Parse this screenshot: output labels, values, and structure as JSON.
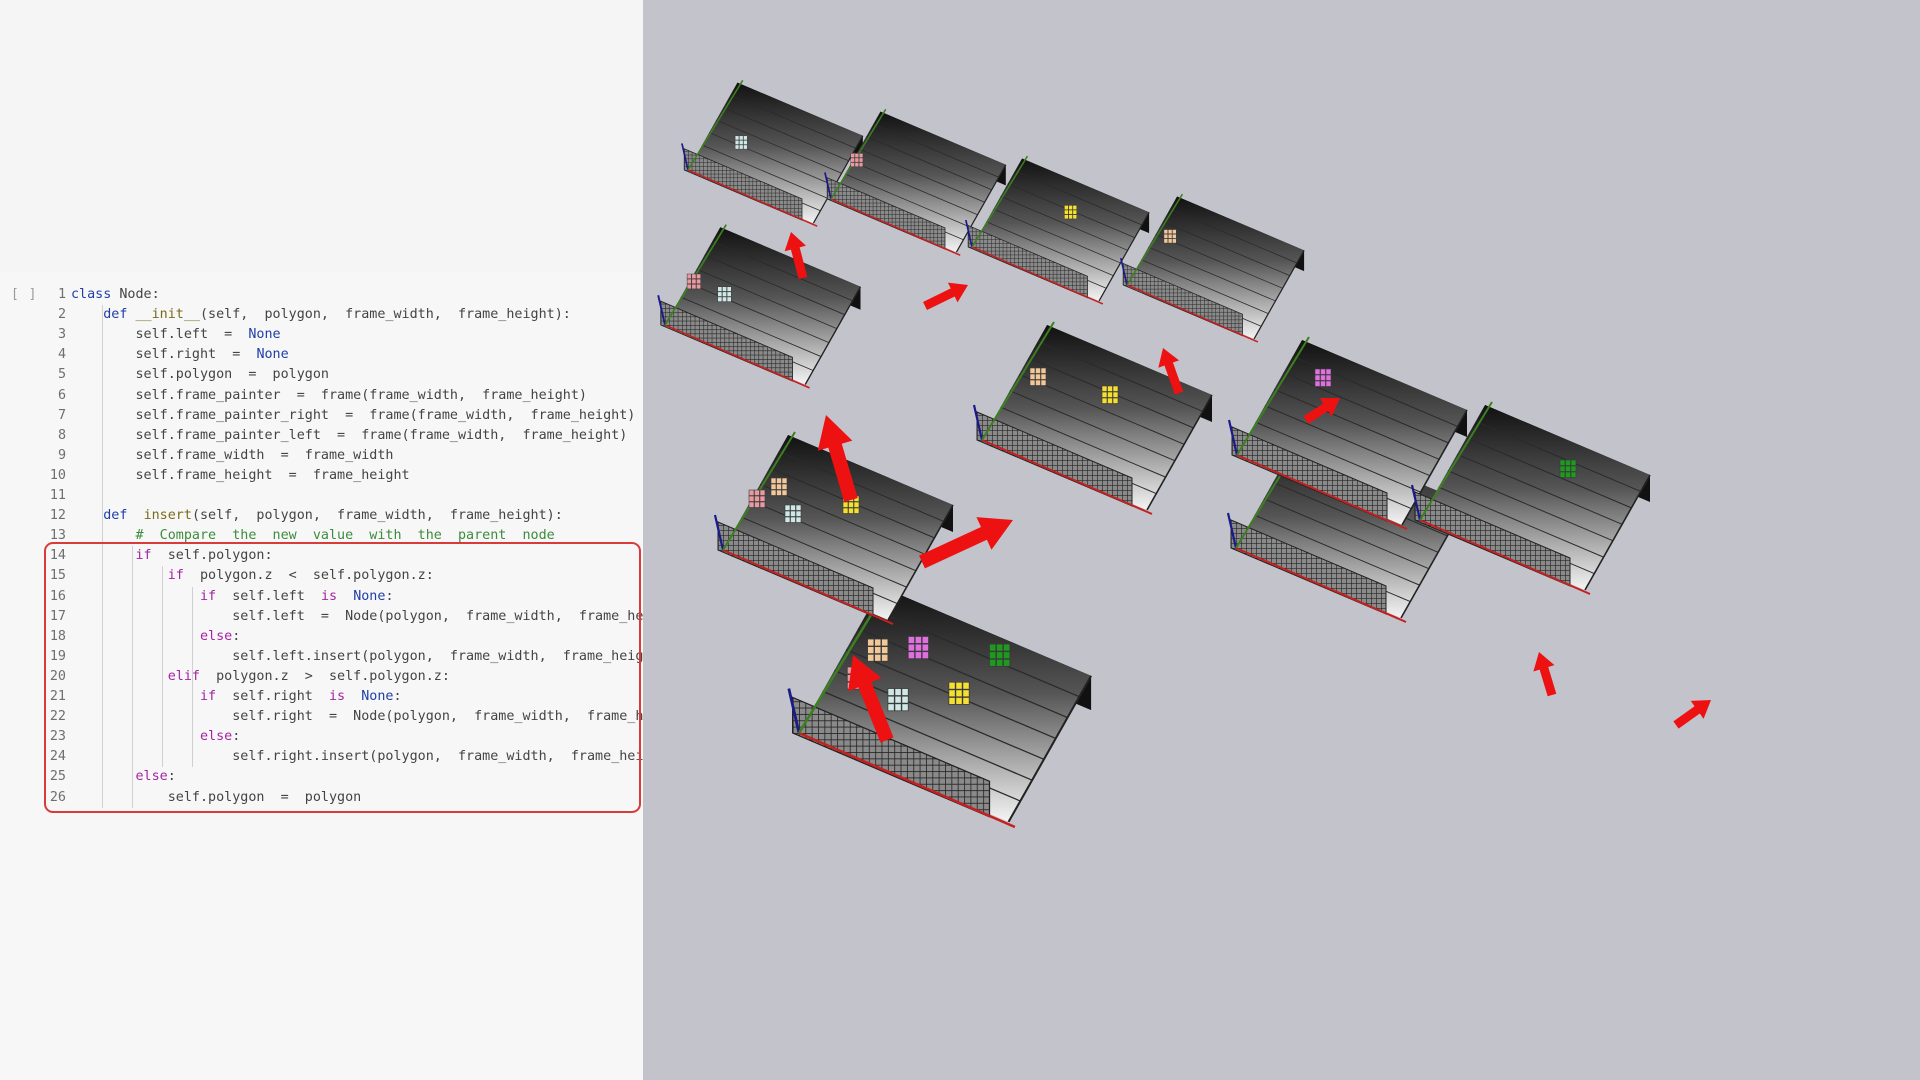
{
  "editor": {
    "run_indicator": "[ ]",
    "lines": [
      {
        "n": "1",
        "tokens": [
          {
            "t": "class",
            "c": "k"
          },
          {
            "t": " Node:"
          }
        ]
      },
      {
        "n": "2",
        "tokens": [
          {
            "t": "    "
          },
          {
            "t": "def",
            "c": "k"
          },
          {
            "t": " "
          },
          {
            "t": "__init__",
            "c": "f"
          },
          {
            "t": "(self,  polygon,  frame_width,  frame_height):"
          }
        ]
      },
      {
        "n": "3",
        "tokens": [
          {
            "t": "        self.left  =  "
          },
          {
            "t": "None",
            "c": "b"
          }
        ]
      },
      {
        "n": "4",
        "tokens": [
          {
            "t": "        self.right  =  "
          },
          {
            "t": "None",
            "c": "b"
          }
        ]
      },
      {
        "n": "5",
        "tokens": [
          {
            "t": "        self.polygon  =  polygon"
          }
        ]
      },
      {
        "n": "6",
        "tokens": [
          {
            "t": "        self.frame_painter  =  frame(frame_width,  frame_height)"
          }
        ]
      },
      {
        "n": "7",
        "tokens": [
          {
            "t": "        self.frame_painter_right  =  frame(frame_width,  frame_height)"
          }
        ]
      },
      {
        "n": "8",
        "tokens": [
          {
            "t": "        self.frame_painter_left  =  frame(frame_width,  frame_height)"
          }
        ]
      },
      {
        "n": "9",
        "tokens": [
          {
            "t": "        self.frame_width  =  frame_width"
          }
        ]
      },
      {
        "n": "10",
        "tokens": [
          {
            "t": "        self.frame_height  =  frame_height"
          }
        ]
      },
      {
        "n": "11",
        "tokens": [
          {
            "t": ""
          }
        ]
      },
      {
        "n": "12",
        "tokens": [
          {
            "t": "    "
          },
          {
            "t": "def",
            "c": "k"
          },
          {
            "t": "  "
          },
          {
            "t": "insert",
            "c": "f"
          },
          {
            "t": "(self,  polygon,  frame_width,  frame_height):"
          }
        ]
      },
      {
        "n": "13",
        "tokens": [
          {
            "t": "        "
          },
          {
            "t": "#  Compare  the  new  value  with  the  parent  node",
            "c": "c"
          }
        ]
      },
      {
        "n": "14",
        "tokens": [
          {
            "t": "        "
          },
          {
            "t": "if",
            "c": "kc"
          },
          {
            "t": "  self.polygon:"
          }
        ]
      },
      {
        "n": "15",
        "tokens": [
          {
            "t": "            "
          },
          {
            "t": "if",
            "c": "kc"
          },
          {
            "t": "  polygon.z  <  self.polygon.z:"
          }
        ]
      },
      {
        "n": "16",
        "tokens": [
          {
            "t": "                "
          },
          {
            "t": "if",
            "c": "kc"
          },
          {
            "t": "  self.left  "
          },
          {
            "t": "is",
            "c": "kc"
          },
          {
            "t": "  "
          },
          {
            "t": "None",
            "c": "b"
          },
          {
            "t": ":"
          }
        ]
      },
      {
        "n": "17",
        "tokens": [
          {
            "t": "                    self.left  =  Node(polygon,  frame_width,  frame_height)"
          }
        ]
      },
      {
        "n": "18",
        "tokens": [
          {
            "t": "                "
          },
          {
            "t": "else",
            "c": "kc"
          },
          {
            "t": ":"
          }
        ]
      },
      {
        "n": "19",
        "tokens": [
          {
            "t": "                    self.left.insert(polygon,  frame_width,  frame_height)"
          }
        ]
      },
      {
        "n": "20",
        "tokens": [
          {
            "t": "            "
          },
          {
            "t": "elif",
            "c": "kc"
          },
          {
            "t": "  polygon.z  >  self.polygon.z:"
          }
        ]
      },
      {
        "n": "21",
        "tokens": [
          {
            "t": "                "
          },
          {
            "t": "if",
            "c": "kc"
          },
          {
            "t": "  self.right  "
          },
          {
            "t": "is",
            "c": "kc"
          },
          {
            "t": "  "
          },
          {
            "t": "None",
            "c": "b"
          },
          {
            "t": ":"
          }
        ]
      },
      {
        "n": "22",
        "tokens": [
          {
            "t": "                    self.right  =  Node(polygon,  frame_width,  frame_height)"
          }
        ]
      },
      {
        "n": "23",
        "tokens": [
          {
            "t": "                "
          },
          {
            "t": "else",
            "c": "kc"
          },
          {
            "t": ":"
          }
        ]
      },
      {
        "n": "24",
        "tokens": [
          {
            "t": "                    self.right.insert(polygon,  frame_width,  frame_height)"
          }
        ]
      },
      {
        "n": "25",
        "tokens": [
          {
            "t": "        "
          },
          {
            "t": "else",
            "c": "kc"
          },
          {
            "t": ":"
          }
        ]
      },
      {
        "n": "26",
        "tokens": [
          {
            "t": "            self.polygon  =  polygon"
          }
        ]
      }
    ]
  },
  "colors": {
    "keyword": "#1f3ea8",
    "control_keyword": "#a425a4",
    "comment": "#3c8c3c",
    "function_name": "#7a6b1a",
    "highlight_border": "#d93a3a",
    "arrow": "#ee1111",
    "viewport_bg": "#c3c3cb",
    "pink": "#e89aa0",
    "cyan": "#cfe8e6",
    "peach": "#f2c89a",
    "yellow": "#f5e030",
    "magenta": "#e070e0",
    "green": "#1e9a1e"
  },
  "scene": {
    "frames": [
      {
        "id": "root",
        "blocks": [
          "pink",
          "peach",
          "magenta",
          "green",
          "cyan",
          "yellow"
        ]
      },
      {
        "id": "left",
        "blocks": [
          "pink",
          "peach",
          "cyan",
          "yellow"
        ]
      },
      {
        "id": "left-left",
        "blocks": [
          "pink",
          "cyan"
        ]
      },
      {
        "id": "left-left-left",
        "blocks": [
          "cyan"
        ]
      },
      {
        "id": "left-left-right",
        "blocks": [
          "pink"
        ]
      },
      {
        "id": "left-right",
        "blocks": [
          "peach",
          "yellow"
        ]
      },
      {
        "id": "left-right-left",
        "blocks": [
          "yellow"
        ]
      },
      {
        "id": "left-right-right",
        "blocks": [
          "peach"
        ]
      },
      {
        "id": "right",
        "blocks": [
          "magenta",
          "green"
        ]
      },
      {
        "id": "right-left",
        "blocks": [
          "magenta"
        ]
      },
      {
        "id": "right-right",
        "blocks": [
          "green"
        ]
      }
    ],
    "arrows": [
      {
        "from": "root",
        "to": "left"
      },
      {
        "from": "left",
        "to": "left-left"
      },
      {
        "from": "left",
        "to": "left-right"
      },
      {
        "from": "left-left",
        "to": "left-left-left"
      },
      {
        "from": "left-left",
        "to": "left-left-right"
      },
      {
        "from": "left-right",
        "to": "left-right-left"
      },
      {
        "from": "left-right",
        "to": "left-right-right"
      },
      {
        "from": "right",
        "to": "right-left"
      },
      {
        "from": "right",
        "to": "right-right"
      }
    ]
  }
}
